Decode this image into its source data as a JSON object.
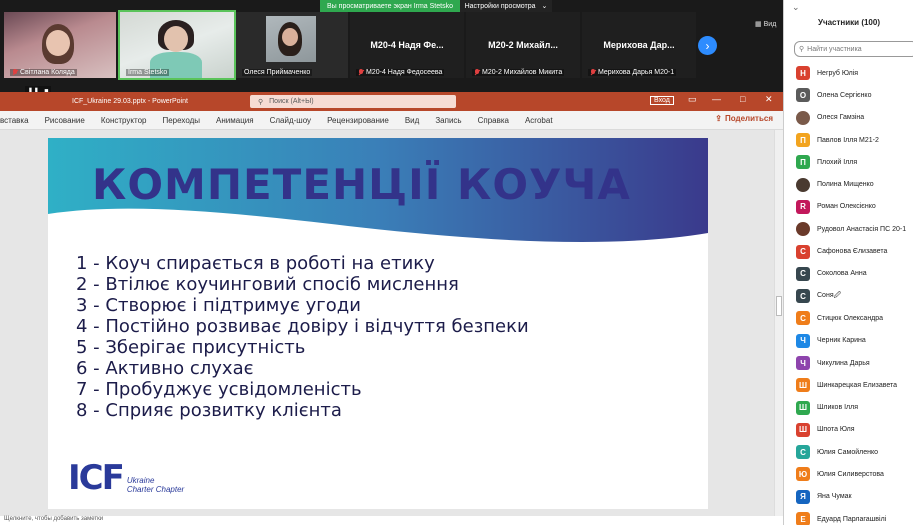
{
  "share_banner": {
    "viewing_text": "Вы просматриваете экран Irma Stetsko",
    "settings_label": "Настройки просмотра",
    "settings_chevron": "chevron-down-icon"
  },
  "video_tiles": [
    {
      "name": "Світлана Колядa",
      "muted": true
    },
    {
      "name": "Irma Stetsko",
      "muted": false
    },
    {
      "name": "Олеся Приймаченко",
      "muted": false
    },
    {
      "big_name": "М20-4 Надя Фе...",
      "name": "М20-4 Надя Федосеева",
      "muted": true
    },
    {
      "big_name": "М20-2 Михайл...",
      "name": "М20-2 Михайлов Микита",
      "muted": true
    },
    {
      "big_name": "Мерихова Дар...",
      "name": "Мерихова Дарья М20-1",
      "muted": true
    }
  ],
  "view_label": "Вид",
  "pause_bar": {
    "pause_glyph": "❚❚",
    "stop_glyph": "■"
  },
  "ppt": {
    "file_title": "ICF_Ukraine 29.03.pptx  -  PowerPoint",
    "search_placeholder": "Поиск (Alt+Ы)",
    "login_label": "Вход",
    "ribbon_tabs": [
      "вставка",
      "Рисование",
      "Конструктор",
      "Переходы",
      "Анимация",
      "Слайд-шоу",
      "Рецензирование",
      "Вид",
      "Запись",
      "Справка",
      "Acrobat"
    ],
    "share_label": "Поделиться",
    "notes_text": "Щелкните, чтобы добавить заметки"
  },
  "slide": {
    "title": "КОМПЕТЕНЦІЇ КОУЧА",
    "items": [
      "1 - Коуч спирається в роботі на етику",
      "2 - Втілює коучинговий спосіб мислення",
      "3 - Створює і підтримує угоди",
      "4 - Постійно розвиває довіру і відчуття безпеки",
      "5 - Зберігає присутність",
      "6 - Активно слухає",
      "7 - Пробуджує усвідомленість",
      "8 - Сприяє розвитку клієнта"
    ],
    "logo_text": "ICF",
    "logo_sub1": "Ukraine",
    "logo_sub2": "Charter Chapter"
  },
  "participants": {
    "title": "Участники (100)",
    "search_placeholder": "Найти участника",
    "list": [
      {
        "initial": "Н",
        "name": "Негруб Юлія",
        "color": "#d9412f"
      },
      {
        "initial": "О",
        "name": "Олена Сергієнко",
        "color": "#5b5b5b"
      },
      {
        "initial": "",
        "name": "Олеся Гамзіна",
        "color": "#7a5a4a",
        "photo": true
      },
      {
        "initial": "П",
        "name": "Павлов Ілля М21-2",
        "color": "#f2a41f"
      },
      {
        "initial": "П",
        "name": "Плохий Ілля",
        "color": "#2fa84f"
      },
      {
        "initial": "",
        "name": "Полина Мищенко",
        "color": "#4a3a30",
        "photo": true
      },
      {
        "initial": "R",
        "name": "Роман Олексієнко",
        "color": "#c2185b"
      },
      {
        "initial": "",
        "name": "Рудовол Анастасія ПС 20-1",
        "color": "#6a3a2a",
        "photo": true
      },
      {
        "initial": "С",
        "name": "Сафонова Єлизавета",
        "color": "#d9412f"
      },
      {
        "initial": "С",
        "name": "Соколова Анна",
        "color": "#37474f"
      },
      {
        "initial": "С",
        "name": "Соня🖉",
        "color": "#37474f"
      },
      {
        "initial": "С",
        "name": "Стицюк Олександра",
        "color": "#ef7d1a"
      },
      {
        "initial": "Ч",
        "name": "Черник Карина",
        "color": "#1e88e5"
      },
      {
        "initial": "Ч",
        "name": "Чикулина Дарья",
        "color": "#8e44ad"
      },
      {
        "initial": "Ш",
        "name": "Шинкарецкая Елизавета",
        "color": "#ef7d1a"
      },
      {
        "initial": "Ш",
        "name": "Шликов Ілля",
        "color": "#2fa84f"
      },
      {
        "initial": "Ш",
        "name": "Шпота Юля",
        "color": "#d9412f"
      },
      {
        "initial": "С",
        "name": "Юлия Самойленко",
        "color": "#26a69a"
      },
      {
        "initial": "Ю",
        "name": "Юлия Силиверстова",
        "color": "#ef7d1a"
      },
      {
        "initial": "Я",
        "name": "Яна Чумак",
        "color": "#1565c0"
      },
      {
        "initial": "Е",
        "name": "Едуард Парлагашвілі",
        "color": "#ef7d1a"
      }
    ]
  },
  "colors": {
    "ppt_accent": "#b7472a",
    "slide_title": "#33338a",
    "banner_start": "#2fb0c6",
    "banner_end": "#3a3a8c"
  }
}
